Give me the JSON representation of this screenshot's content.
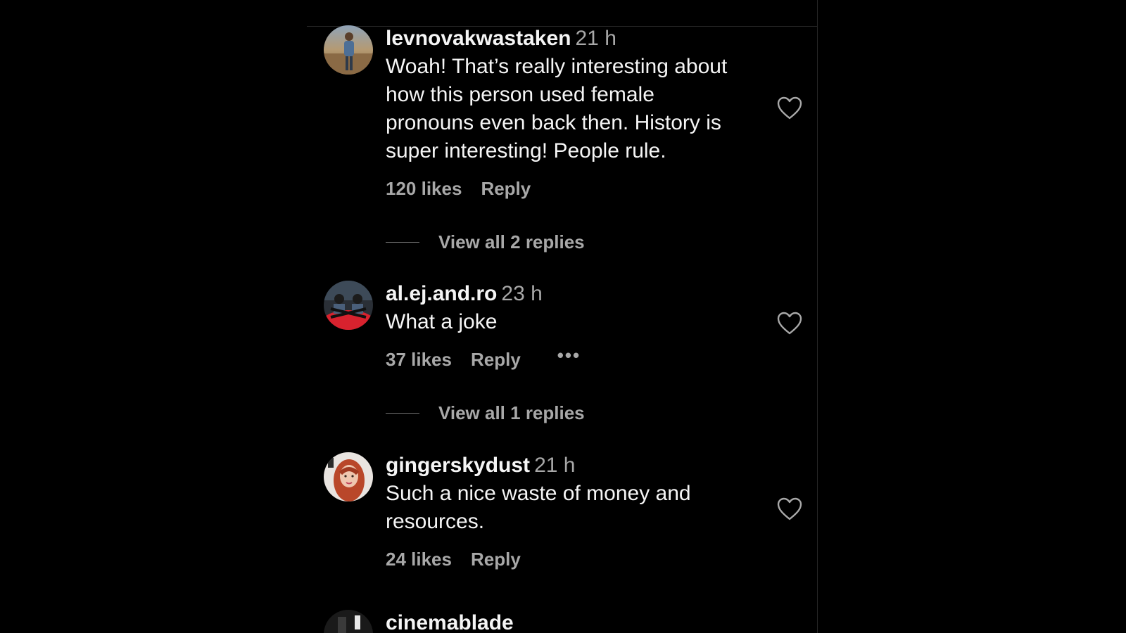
{
  "comments": [
    {
      "username": "levnovakwastaken",
      "time": "21 h",
      "text_lines": [
        "Woah! That’s really interesting about",
        "how this person used female",
        "pronouns even back then. History is",
        "super interesting! People rule."
      ],
      "likes": "120 likes",
      "reply": "Reply",
      "view_replies": "View all 2 replies"
    },
    {
      "username": "al.ej.and.ro",
      "time": "23 h",
      "text_lines": [
        "What a joke"
      ],
      "likes": "37 likes",
      "reply": "Reply",
      "more": "•••",
      "view_replies": "View all 1 replies"
    },
    {
      "username": "gingerskydust",
      "time": "21 h",
      "text_lines": [
        "Such a nice waste of money and",
        "resources."
      ],
      "likes": "24 likes",
      "reply": "Reply"
    },
    {
      "username": "cinemablade"
    }
  ],
  "icons": {
    "like": "heart-icon",
    "more": "more-options-icon"
  },
  "colors": {
    "background": "#000000",
    "primary_text": "#f5f5f5",
    "secondary_text": "#a8a8a8",
    "divider": "#262626"
  }
}
